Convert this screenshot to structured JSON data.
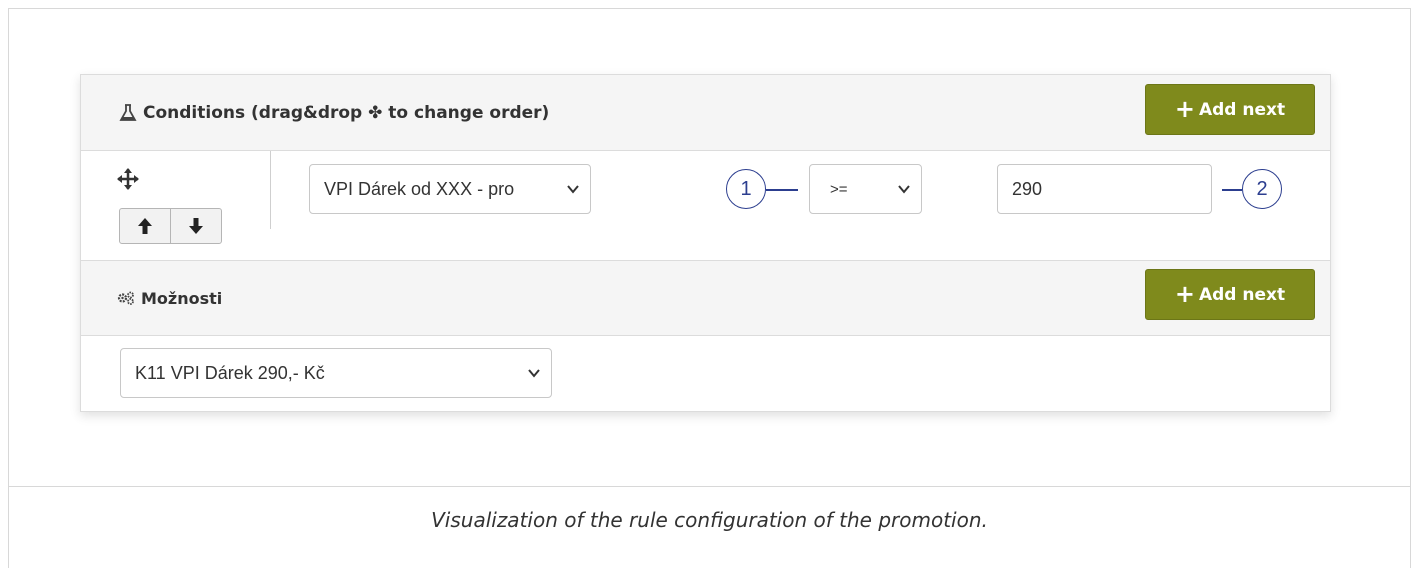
{
  "conditions": {
    "title": "Conditions (drag&drop ✤ to change order)",
    "add_button_label": "Add next",
    "row": {
      "product_select_value": "VPI Dárek od XXX - pro",
      "operator_select_value": ">=",
      "amount_value": "290"
    },
    "icons": {
      "header": "flask-icon",
      "move": "move-icon",
      "up": "arrow-up-icon",
      "down": "arrow-down-icon",
      "dropdown": "chevron-down-icon"
    }
  },
  "options": {
    "title": "Možnosti",
    "add_button_label": "Add next",
    "select_value": "K11 VPI Dárek 290,- Kč",
    "icons": {
      "header": "cogs-icon"
    }
  },
  "markers": [
    "1",
    "2"
  ],
  "caption": "Visualization of the rule configuration of the promotion.",
  "colors": {
    "button_bg": "#7f8a1c",
    "marker": "#2c3e8f",
    "header_bg": "#f5f5f5"
  }
}
